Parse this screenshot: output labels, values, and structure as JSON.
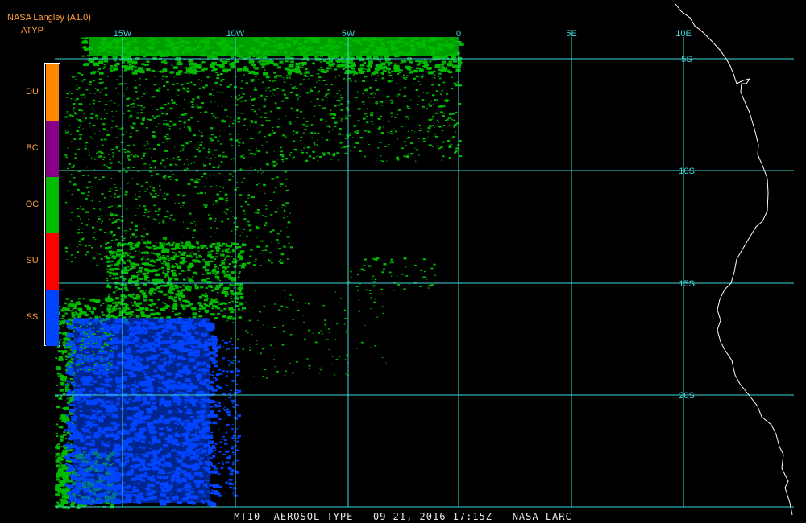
{
  "header": {
    "source": "NASA Langley (A1.0)",
    "product": "ATYP"
  },
  "legend": [
    {
      "code": "DU",
      "color": "#ff8800"
    },
    {
      "code": "BC",
      "color": "#880088"
    },
    {
      "code": "OC",
      "color": "#00bb00"
    },
    {
      "code": "SU",
      "color": "#ff0000"
    },
    {
      "code": "SS",
      "color": "#0044ff"
    }
  ],
  "map": {
    "grid_color": "#40d8d8",
    "coast_color": "#ffffff",
    "longitude_labels": [
      "15W",
      "10W",
      "5W",
      "0",
      "5E",
      "10E"
    ],
    "latitude_labels": [
      "5S",
      "10S",
      "15S",
      "20S"
    ]
  },
  "footer": {
    "text": "MT10  AEROSOL TYPE   09 21, 2016 17:15Z   NASA LARC"
  }
}
